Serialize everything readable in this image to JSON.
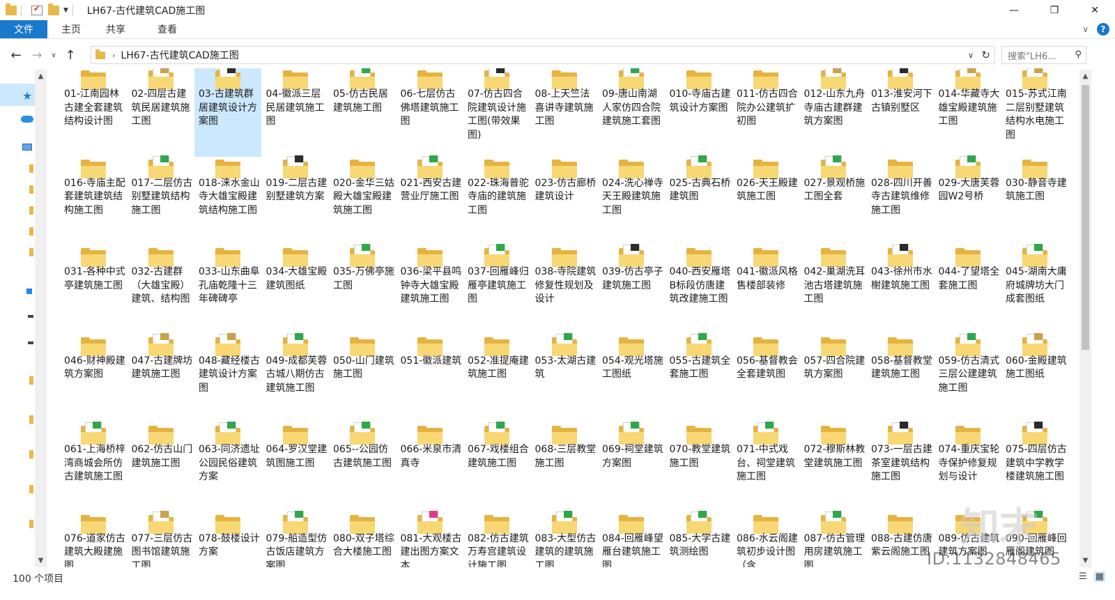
{
  "window": {
    "title": "LH67-古代建筑CAD施工图",
    "min_glyph": "—",
    "max_glyph": "❐",
    "close_glyph": "✕"
  },
  "ribbon": {
    "tabs": [
      "文件",
      "主页",
      "共享",
      "查看"
    ],
    "collapse_glyph": "∨",
    "help_glyph": "?"
  },
  "nav": {
    "back_glyph": "←",
    "forward_glyph": "→",
    "recent_glyph": "∨",
    "up_glyph": "↑",
    "address": "LH67-古代建筑CAD施工图",
    "breadcrumb_sep": "›",
    "addr_drop_glyph": "∨",
    "refresh_glyph": "↻",
    "search_placeholder": "搜索\"LH6...",
    "search_glyph": "⚲"
  },
  "status": {
    "count": "100 个项目"
  },
  "watermark": {
    "id_text": "ID:1132848465",
    "logo_text": "知末"
  },
  "colors": {
    "accent": "#1979ca",
    "folder": "#e6b340",
    "folder_front": "#f8d775",
    "selection": "#cce8ff"
  },
  "folders": [
    {
      "label": "01-江南园林古建全套建筑结构设计图",
      "mark": "none"
    },
    {
      "label": "02-四层古建筑民居建筑施工图",
      "mark": "small"
    },
    {
      "label": "03-古建筑群居建筑设计方案图",
      "mark": "dark",
      "selected": true
    },
    {
      "label": "04-徽派三层民居建筑施工图",
      "mark": "none"
    },
    {
      "label": "05-仿古民居建筑施工图",
      "mark": "green"
    },
    {
      "label": "06-七层仿古佛塔建筑施工图",
      "mark": "none"
    },
    {
      "label": "07-仿古四合院建筑设计施工图(带效果图)",
      "mark": "dark"
    },
    {
      "label": "08-上天竺法喜讲寺建筑施工图",
      "mark": "none"
    },
    {
      "label": "09-唐山南湖人家仿四合院建筑施工套图",
      "mark": "green"
    },
    {
      "label": "010-寺庙古建筑设计方案图",
      "mark": "none"
    },
    {
      "label": "011-仿古四合院办公建筑扩初图",
      "mark": "none"
    },
    {
      "label": "012-山东九舟寺庙古建群建筑方案图",
      "mark": "small"
    },
    {
      "label": "013-淮安河下古镇别墅区",
      "mark": "dark"
    },
    {
      "label": "014-华藏寺大雄宝殿建筑施工图",
      "mark": "small"
    },
    {
      "label": "015-苏式江南二层别墅建筑结构水电施工图",
      "mark": "small"
    },
    {
      "label": "016-寺庙主配套建筑建筑结构施工图",
      "mark": "none"
    },
    {
      "label": "017-二层仿古别墅建筑结构施工图",
      "mark": "green"
    },
    {
      "label": "018-涞水金山寺大雄宝殿建筑结构施工图",
      "mark": "none"
    },
    {
      "label": "019-二层古建别墅建筑方案",
      "mark": "dark"
    },
    {
      "label": "020-金华三姑殿大雄宝殿建筑施工图",
      "mark": "none"
    },
    {
      "label": "021-西安古建营业厅施工图",
      "mark": "green"
    },
    {
      "label": "022-珠海普驼寺庙的建筑施工图",
      "mark": "none"
    },
    {
      "label": "023-仿古廊桥建筑设计",
      "mark": "none"
    },
    {
      "label": "024-洗心禅寺天王殿建筑施工图",
      "mark": "none"
    },
    {
      "label": "025-古典石桥建筑图",
      "mark": "green"
    },
    {
      "label": "026-天王殿建筑施工图",
      "mark": "none"
    },
    {
      "label": "027-景观桥施工图全套",
      "mark": "green"
    },
    {
      "label": "028-四川开善寺古建筑维修施工图",
      "mark": "none"
    },
    {
      "label": "029-大唐芙蓉园W2号桥",
      "mark": "green"
    },
    {
      "label": "030-静音寺建筑施工图",
      "mark": "none"
    },
    {
      "label": "031-各种中式亭建筑施工图",
      "mark": "none"
    },
    {
      "label": "032-古建群（大雄宝殿）建筑、结构图",
      "mark": "none"
    },
    {
      "label": "033-山东曲阜孔庙乾隆十三年碑碑亭",
      "mark": "none"
    },
    {
      "label": "034-大雄宝殿建筑图纸",
      "mark": "none"
    },
    {
      "label": "035-万佛亭施工图",
      "mark": "green"
    },
    {
      "label": "036-梁平县鸣钟寺大雄宝殿建筑施工图",
      "mark": "none"
    },
    {
      "label": "037-回雁峰归雁亭建筑施工图",
      "mark": "green"
    },
    {
      "label": "038-寺院建筑修复性规划及设计",
      "mark": "none"
    },
    {
      "label": "039-仿古亭子建筑施工图",
      "mark": "dark"
    },
    {
      "label": "040-西安雁塔B标段仿唐建筑改建施工图",
      "mark": "none"
    },
    {
      "label": "041-徽派风格售楼部装修",
      "mark": "none"
    },
    {
      "label": "042-巢湖洗耳池古塔建筑施工图",
      "mark": "none"
    },
    {
      "label": "043-徐州市水榭建筑施工图",
      "mark": "dark"
    },
    {
      "label": "044-了望塔全套施工图",
      "mark": "none"
    },
    {
      "label": "045-湖南大庸府城牌坊大门成套图纸",
      "mark": "green"
    },
    {
      "label": "046-财神殿建筑方案图",
      "mark": "none"
    },
    {
      "label": "047-古建牌坊建筑施工图",
      "mark": "small"
    },
    {
      "label": "048-藏经楼古建筑设计方案图",
      "mark": "small"
    },
    {
      "label": "049-成都芙蓉古城八期仿古建筑施工图",
      "mark": "green"
    },
    {
      "label": "050-山门建筑施工图",
      "mark": "none"
    },
    {
      "label": "051-徽派建筑",
      "mark": "none"
    },
    {
      "label": "052-准提庵建筑施工图",
      "mark": "none"
    },
    {
      "label": "053-太湖古建筑",
      "mark": "green"
    },
    {
      "label": "054-观光塔施工图纸",
      "mark": "none"
    },
    {
      "label": "055-古建筑全套施工图",
      "mark": "green"
    },
    {
      "label": "056-基督教会全套建筑图",
      "mark": "none"
    },
    {
      "label": "057-四合院建筑方案图",
      "mark": "none"
    },
    {
      "label": "058-基督教堂建筑施工图",
      "mark": "none"
    },
    {
      "label": "059-仿古清式三层公建建筑施工图",
      "mark": "green"
    },
    {
      "label": "060-金殿建筑施工图纸",
      "mark": "small"
    },
    {
      "label": "061-上海桥梓湾商城会所仿古建筑施工图",
      "mark": "green"
    },
    {
      "label": "062-仿古山门建筑施工图",
      "mark": "none"
    },
    {
      "label": "063-同济遗址公园民俗建筑方案",
      "mark": "green"
    },
    {
      "label": "064-罗汉堂建筑图施工图",
      "mark": "none"
    },
    {
      "label": "065--公园仿古建筑施工图",
      "mark": "green"
    },
    {
      "label": "066-米泉市清真寺",
      "mark": "none"
    },
    {
      "label": "067-戏楼组合建筑施工图",
      "mark": "green"
    },
    {
      "label": "068-三层教堂施工图",
      "mark": "none"
    },
    {
      "label": "069-祠堂建筑方案图",
      "mark": "green"
    },
    {
      "label": "070-教堂建筑施工图",
      "mark": "none"
    },
    {
      "label": "071-中式戏台、祠堂建筑施工图",
      "mark": "green"
    },
    {
      "label": "072-穆斯林教堂建筑施工图",
      "mark": "none"
    },
    {
      "label": "073-一层古建茶室建筑结构施工图",
      "mark": "dark"
    },
    {
      "label": "074-重庆宝轮寺保护修复规划与设计",
      "mark": "none"
    },
    {
      "label": "075-四层仿古建筑中学教学楼建筑施工图",
      "mark": "dark"
    },
    {
      "label": "076-道家仿古建筑大殿建施图",
      "mark": "none"
    },
    {
      "label": "077-三层仿古图书馆建筑施工图",
      "mark": "small"
    },
    {
      "label": "078-鼓楼设计方案",
      "mark": "none"
    },
    {
      "label": "079-船造型仿古饭店建筑方案图",
      "mark": "green"
    },
    {
      "label": "080-双子塔综合大楼施工图",
      "mark": "none"
    },
    {
      "label": "081-大观楼古建出图方案文本",
      "mark": "pink"
    },
    {
      "label": "082-仿古建筑万寿宫建筑设计施工图",
      "mark": "none"
    },
    {
      "label": "083-大型仿古建筑的建筑施工图",
      "mark": "green"
    },
    {
      "label": "084-回雁峰望雁台建筑施工图",
      "mark": "none"
    },
    {
      "label": "085-大学古建筑测绘图",
      "mark": "green"
    },
    {
      "label": "086-水云阁建筑初步设计图（含",
      "mark": "none"
    },
    {
      "label": "087-仿古管理用房建筑施工图",
      "mark": "green"
    },
    {
      "label": "088-古建仿唐紫云阁施工图",
      "mark": "none"
    },
    {
      "label": "089-仿古建筑建筑方案图",
      "mark": "none"
    },
    {
      "label": "090-回雁峰回雁阁建筑图",
      "mark": "green"
    }
  ]
}
